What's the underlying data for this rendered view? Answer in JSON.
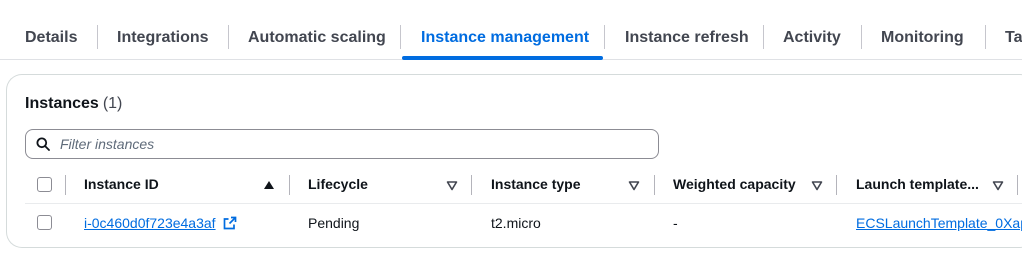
{
  "tabs": [
    {
      "label": "Details"
    },
    {
      "label": "Integrations"
    },
    {
      "label": "Automatic scaling"
    },
    {
      "label": "Instance management"
    },
    {
      "label": "Instance refresh"
    },
    {
      "label": "Activity"
    },
    {
      "label": "Monitoring"
    },
    {
      "label": "Ta"
    }
  ],
  "active_tab": "Instance management",
  "panel": {
    "title": "Instances",
    "count": "(1)",
    "filter_placeholder": "Filter instances"
  },
  "table": {
    "columns": [
      {
        "label": "Instance ID",
        "sort": "ascending"
      },
      {
        "label": "Lifecycle",
        "sort": "none"
      },
      {
        "label": "Instance type",
        "sort": "none"
      },
      {
        "label": "Weighted capacity",
        "sort": "none"
      },
      {
        "label": "Launch template...",
        "sort": "none"
      }
    ],
    "rows": [
      {
        "instance_id": "i-0c460d0f723e4a3af",
        "lifecycle": "Pending",
        "instance_type": "t2.micro",
        "weighted_capacity": "-",
        "launch_template": "ECSLaunchTemplate_0Xap"
      }
    ]
  },
  "colors": {
    "accent": "#006ce0",
    "text": "#0f141a",
    "tab_text": "#424650",
    "border": "#d5dbdb"
  }
}
